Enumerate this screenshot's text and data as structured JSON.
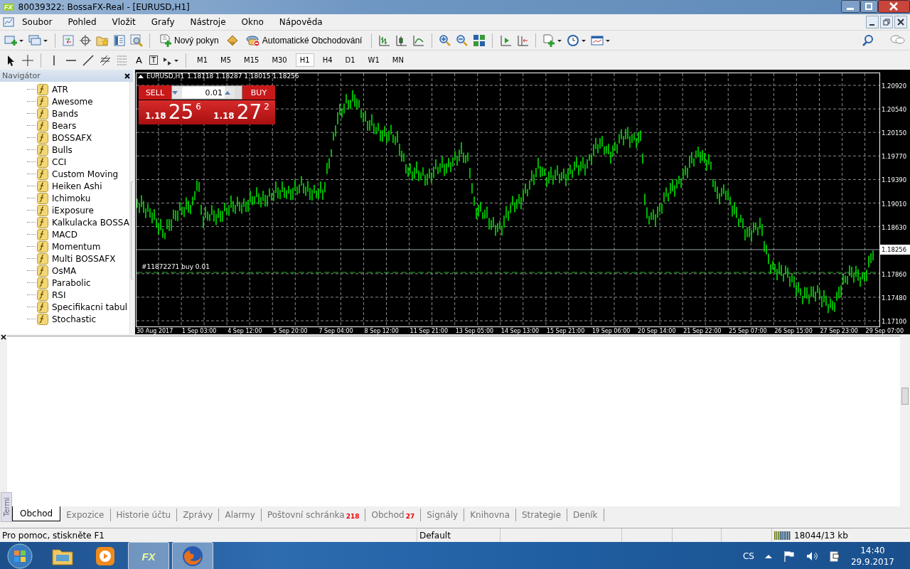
{
  "window": {
    "logo": "FX",
    "title": "80039322: BossaFX-Real - [EURUSD,H1]"
  },
  "menu": [
    "Soubor",
    "Pohled",
    "Vložit",
    "Grafy",
    "Nástroje",
    "Okno",
    "Nápověda"
  ],
  "toolbar": {
    "new_order": "Nový pokyn",
    "auto_trading": "Automatické Obchodování"
  },
  "drawing_toolbar": {
    "text_tool": "A",
    "label_tool": "T",
    "timeframes": [
      {
        "label": "M1",
        "selected": false
      },
      {
        "label": "M5",
        "selected": false
      },
      {
        "label": "M15",
        "selected": false
      },
      {
        "label": "M30",
        "selected": false
      },
      {
        "label": "H1",
        "selected": true
      },
      {
        "label": "H4",
        "selected": false
      },
      {
        "label": "D1",
        "selected": false
      },
      {
        "label": "W1",
        "selected": false
      },
      {
        "label": "MN",
        "selected": false
      }
    ]
  },
  "navigator": {
    "title": "Navigátor",
    "items": [
      "ATR",
      "Awesome",
      "Bands",
      "Bears",
      "BOSSAFX",
      "Bulls",
      "CCI",
      "Custom Moving",
      "Heiken Ashi",
      "Ichimoku",
      "iExposure",
      "Kalkulacka BOSSA",
      "MACD",
      "Momentum",
      "Multi BOSSAFX",
      "OsMA",
      "Parabolic",
      "RSI",
      "Specifikacni tabul",
      "Stochastic"
    ]
  },
  "chart": {
    "symbol": "EURUSD,H1",
    "ohlc": "1.18118 1.18287 1.18015 1.18256",
    "trade_panel": {
      "sell_label": "SELL",
      "buy_label": "BUY",
      "lot": "0.01",
      "bid": {
        "prefix": "1.18",
        "big": "25",
        "pip": "6"
      },
      "ask": {
        "prefix": "1.18",
        "big": "27",
        "pip": "2"
      }
    },
    "order_line": "#11872271 buy 0.01",
    "price_labels": [
      "1.20920",
      "1.20540",
      "1.20150",
      "1.19770",
      "1.19390",
      "1.19010",
      "1.18630",
      "1.17860",
      "1.17480",
      "1.17100"
    ],
    "current_price": "1.18256",
    "time_labels": [
      "30 Aug 2017",
      "1 Sep 03:00",
      "4 Sep 12:00",
      "5 Sep 20:00",
      "7 Sep 04:00",
      "8 Sep 12:00",
      "11 Sep 21:00",
      "13 Sep 05:00",
      "14 Sep 13:00",
      "15 Sep 21:00",
      "19 Sep 06:00",
      "20 Sep 14:00",
      "21 Sep 22:00",
      "25 Sep 07:00",
      "26 Sep 15:00",
      "27 Sep 23:00",
      "29 Sep 07:00"
    ]
  },
  "terminal": {
    "side_label": "Termi",
    "tabs": [
      {
        "label": "Obchod",
        "selected": true
      },
      {
        "label": "Expozice",
        "selected": false
      },
      {
        "label": "Historie účtu",
        "selected": false
      },
      {
        "label": "Zprávy",
        "selected": false
      },
      {
        "label": "Alarmy",
        "selected": false
      },
      {
        "label": "Poštovní schránka",
        "badge": "218",
        "selected": false
      },
      {
        "label": "Obchod",
        "badge": "27",
        "selected": false
      },
      {
        "label": "Signály",
        "selected": false
      },
      {
        "label": "Knihovna",
        "selected": false
      },
      {
        "label": "Strategie",
        "selected": false
      },
      {
        "label": "Deník",
        "selected": false
      }
    ]
  },
  "status_bar": {
    "help": "Pro pomoc, stiskněte F1",
    "profile": "Default",
    "traffic": "18044/13 kb"
  },
  "taskbar": {
    "fx_logo": "FX",
    "language": "CS",
    "time": "14:40",
    "date": "29.9.2017"
  }
}
